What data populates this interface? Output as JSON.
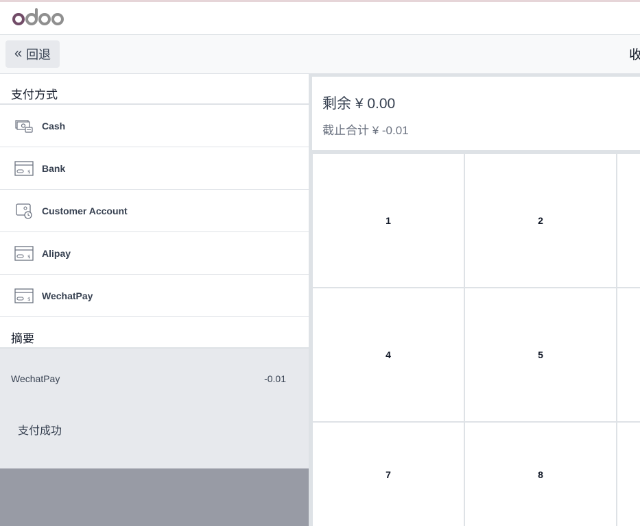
{
  "header": {
    "back_label": "回退",
    "confirm_label": "收"
  },
  "payment_methods_section": {
    "title": "支付方式",
    "items": [
      {
        "label": "Cash",
        "icon": "cash-icon"
      },
      {
        "label": "Bank",
        "icon": "card-icon"
      },
      {
        "label": "Customer Account",
        "icon": "customer-account-icon"
      },
      {
        "label": "Alipay",
        "icon": "card-icon"
      },
      {
        "label": "WechatPay",
        "icon": "card-icon"
      }
    ]
  },
  "summary": {
    "title": "摘要",
    "lines": [
      {
        "method": "WechatPay",
        "amount": "-0.01"
      }
    ],
    "status": "支付成功"
  },
  "amounts": {
    "remaining": "剩余 ¥ 0.00",
    "total": "截止合计 ¥ -0.01"
  },
  "numpad": {
    "keys": [
      "1",
      "2",
      "4",
      "5",
      "7",
      "8"
    ]
  },
  "colors": {
    "logo_purple": "#714b67",
    "logo_gray": "#8f8f8f",
    "summary_bg": "#e7e9ed",
    "footer_gray": "#989ba5"
  }
}
